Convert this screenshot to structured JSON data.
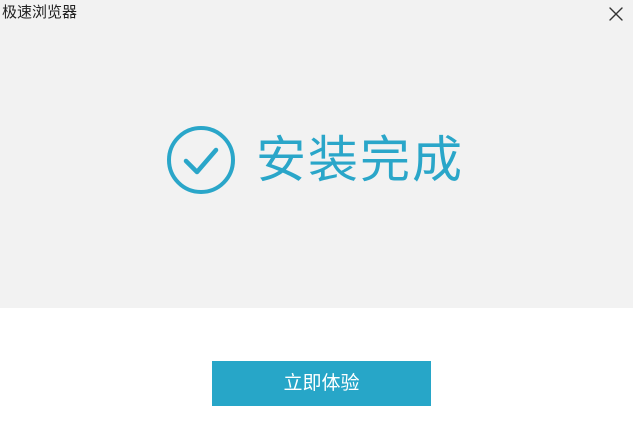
{
  "window": {
    "title": "极速浏览器"
  },
  "status": {
    "icon": "check-circle-icon",
    "text": "安装完成"
  },
  "actions": {
    "primary_label": "立即体验"
  },
  "colors": {
    "accent": "#27a6c8",
    "top_background": "#f2f2f2",
    "page_background": "#ffffff"
  }
}
